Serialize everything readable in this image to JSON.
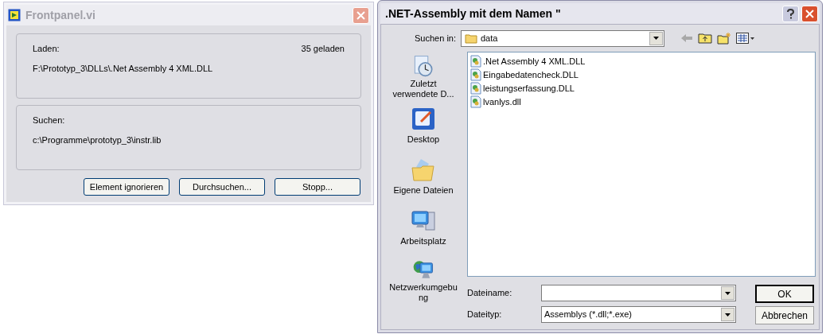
{
  "frontpanel_window": {
    "title": "Frontpanel.vi",
    "load_group": {
      "label": "Laden:",
      "count": "35 geladen",
      "path": "F:\\Prototyp_3\\DLLs\\.Net Assembly 4 XML.DLL"
    },
    "search_group": {
      "label": "Suchen:",
      "path": "c:\\Programme\\prototyp_3\\instr.lib"
    },
    "buttons": [
      "Element ignorieren",
      "Durchsuchen...",
      "Stopp..."
    ]
  },
  "file_dialog": {
    "title": ".NET-Assembly mit dem Namen \"",
    "look_in": {
      "label": "Suchen in:",
      "value": "data"
    },
    "places": [
      {
        "kind": "recent",
        "label": "Zuletzt verwendete D..."
      },
      {
        "kind": "desktop",
        "label": "Desktop"
      },
      {
        "kind": "documents",
        "label": "Eigene Dateien"
      },
      {
        "kind": "computer",
        "label": "Arbeitsplatz"
      },
      {
        "kind": "network",
        "label": "Netzwerkumgebung"
      }
    ],
    "files": [
      ".Net Assembly 4 XML.DLL",
      "Eingabedatencheck.DLL",
      "leistungserfassung.DLL",
      "lvanlys.dll"
    ],
    "file_name": {
      "label": "Dateiname:"
    },
    "file_type": {
      "label": "Dateityp:",
      "value": "Assemblys (*.dll;*.exe)"
    },
    "buttons": [
      "OK",
      "Abbrechen"
    ]
  }
}
